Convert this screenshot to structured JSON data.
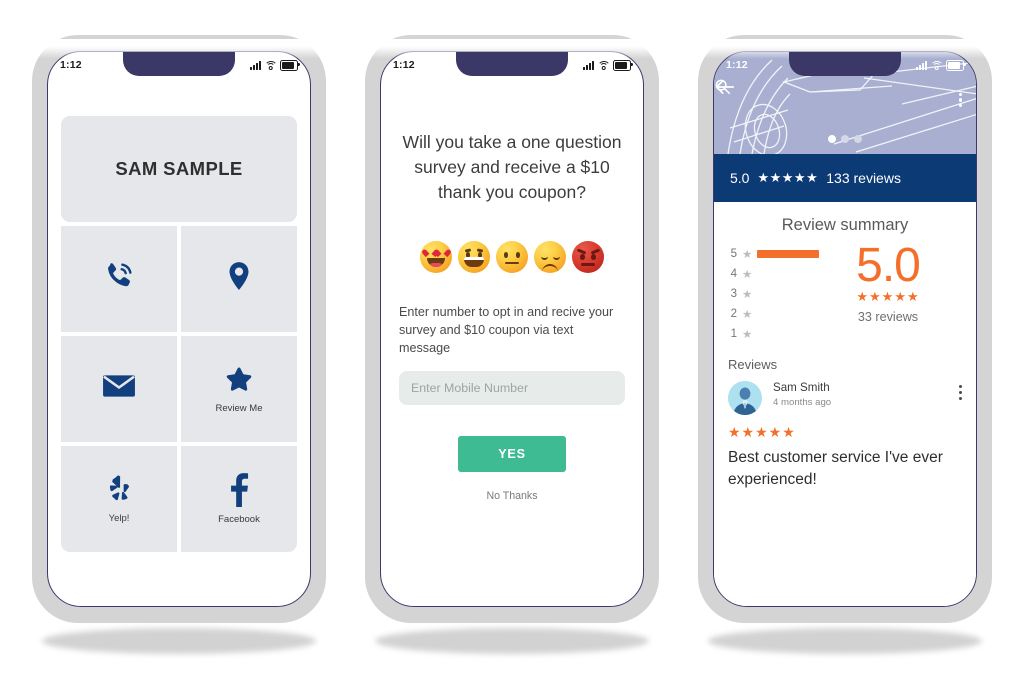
{
  "phones": [
    {
      "id": "business-card",
      "status_bar": {
        "time": "1:12",
        "icons": [
          "signal-icon",
          "wifi-icon",
          "battery-icon"
        ]
      },
      "business_name": "SAM SAMPLE",
      "tiles": [
        {
          "icon": "phone-call-icon",
          "label": ""
        },
        {
          "icon": "map-pin-icon",
          "label": ""
        },
        {
          "icon": "envelope-icon",
          "label": ""
        },
        {
          "icon": "star-icon",
          "label": "Review Me"
        },
        {
          "icon": "yelp-icon",
          "label": "Yelp!"
        },
        {
          "icon": "facebook-icon",
          "label": "Facebook"
        }
      ]
    },
    {
      "id": "survey-optin",
      "status_bar": {
        "time": "1:12",
        "icons": [
          "signal-icon",
          "wifi-icon",
          "battery-icon"
        ]
      },
      "question": "Will you take a one question survey and receive a $10 thank you coupon?",
      "emojis": [
        {
          "name": "heart-eyes-emoji",
          "mood": "love"
        },
        {
          "name": "grinning-emoji",
          "mood": "happy"
        },
        {
          "name": "neutral-emoji",
          "mood": "neutral"
        },
        {
          "name": "sad-emoji",
          "mood": "sad"
        },
        {
          "name": "angry-emoji",
          "mood": "angry"
        }
      ],
      "optin_text": "Enter number to opt in and recive your survey and $10 coupon via text message",
      "input_placeholder": "Enter Mobile Number",
      "input_value": "",
      "yes_label": "YES",
      "no_thanks_label": "No Thanks"
    },
    {
      "id": "reviews",
      "status_bar": {
        "time": "1:12",
        "icons": [
          "signal-icon",
          "wifi-icon",
          "battery-icon"
        ]
      },
      "hero": {
        "back_icon": "back-arrow-icon",
        "search_icon": "search-icon",
        "menu_icon": "kebab-menu-icon",
        "carousel_dots": 3,
        "carousel_active": 1
      },
      "band": {
        "rating": "5.0",
        "stars": "★★★★★",
        "reviews_text": "133 reviews"
      },
      "summary": {
        "title": "Review summary",
        "score": "5.0",
        "score_stars": "★★★★★",
        "reviews_text": "33 reviews",
        "distribution": [
          {
            "label": "5",
            "star": "★",
            "percent": 100
          },
          {
            "label": "4",
            "star": "★",
            "percent": 0
          },
          {
            "label": "3",
            "star": "★",
            "percent": 0
          },
          {
            "label": "2",
            "star": "★",
            "percent": 0
          },
          {
            "label": "1",
            "star": "★",
            "percent": 0
          }
        ]
      },
      "reviews_heading": "Reviews",
      "review": {
        "avatar": "user-avatar-icon",
        "author": "Sam Smith",
        "time_ago": "4 months ago",
        "stars": "★★★★★",
        "body": "Best customer service I've ever experienced!",
        "menu_icon": "kebab-menu-icon"
      }
    }
  ],
  "colors": {
    "brand_blue": "#12407e",
    "band_navy": "#0b3a74",
    "hero_periwinkle": "#a8afd0",
    "accent_orange": "#f4702a",
    "yes_green": "#3ebb93",
    "tile_gray": "#e5e7eb",
    "frame_gray": "#d4d4d4",
    "notch_navy": "#3b3867"
  }
}
